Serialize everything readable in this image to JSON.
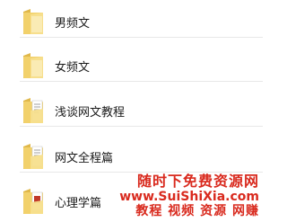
{
  "folders": [
    {
      "label": "男频文",
      "icon": "folder-icon"
    },
    {
      "label": "女频文",
      "icon": "folder-icon"
    },
    {
      "label": "浅谈网文教程",
      "icon": "folder-with-documents-icon"
    },
    {
      "label": "网文全程篇",
      "icon": "folder-with-documents-icon"
    },
    {
      "label": "心理学篇",
      "icon": "folder-with-documents-icon"
    }
  ],
  "watermark": {
    "line1": "随时下免费资源网",
    "line2": "www.SuiShiXia.com",
    "line3": "教程 视频 资源 网赚"
  },
  "colors": {
    "folder_yellow": "#f2d16b",
    "folder_shadow": "#e0b84a",
    "watermark_red": "#d92a1e"
  }
}
